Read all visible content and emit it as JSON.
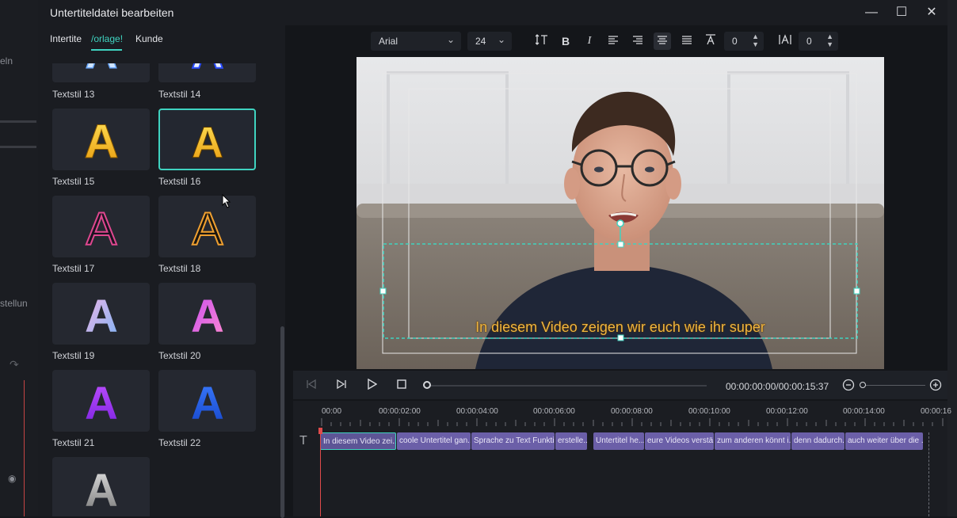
{
  "background_app": {
    "labels": [
      "eln",
      "stellun"
    ]
  },
  "dialog": {
    "title": "Untertiteldatei bearbeiten",
    "window_controls": {
      "minimize": "—",
      "maximize": "☐",
      "close": "✕"
    }
  },
  "left_panel": {
    "tabs": [
      {
        "label": "Intertite",
        "active": false
      },
      {
        "label": "/orlage!",
        "active": true
      },
      {
        "label": "Kunde",
        "active": false
      }
    ],
    "styles": [
      {
        "label": "Textstil 13"
      },
      {
        "label": "Textstil 14"
      },
      {
        "label": "Textstil 15"
      },
      {
        "label": "Textstil 16",
        "selected": true
      },
      {
        "label": "Textstil 17"
      },
      {
        "label": "Textstil 18"
      },
      {
        "label": "Textstil 19"
      },
      {
        "label": "Textstil 20"
      },
      {
        "label": "Textstil 21"
      },
      {
        "label": "Textstil 22"
      }
    ],
    "glyph": "A"
  },
  "toolbar": {
    "font": "Arial",
    "size": "24",
    "line_spacing_value": "0",
    "letter_spacing_value": "0"
  },
  "preview": {
    "subtitle": "In diesem Video zeigen wir euch wie ihr super"
  },
  "playback": {
    "timecode": "00:00:00:00/00:00:15:37"
  },
  "timeline": {
    "ruler": [
      "00:00",
      "00:00:02:00",
      "00:00:04:00",
      "00:00:06:00",
      "00:00:08:00",
      "00:00:10:00",
      "00:00:12:00",
      "00:00:14:00",
      "00:00:16"
    ],
    "clips": [
      "In diesem Video zei...",
      "coole Untertitel gan...",
      "Sprache zu Text Funkti...",
      "erstelle...",
      "Untertitel he...",
      "eure Videos verstä...",
      "zum anderen könnt i...",
      "denn dadurch...",
      "auch weiter über die ..."
    ]
  },
  "colors": {
    "accent": "#3fd3c0",
    "clip": "#6b5fa8",
    "subtitle_text": "#f0b640",
    "playhead": "#e14b4b"
  }
}
